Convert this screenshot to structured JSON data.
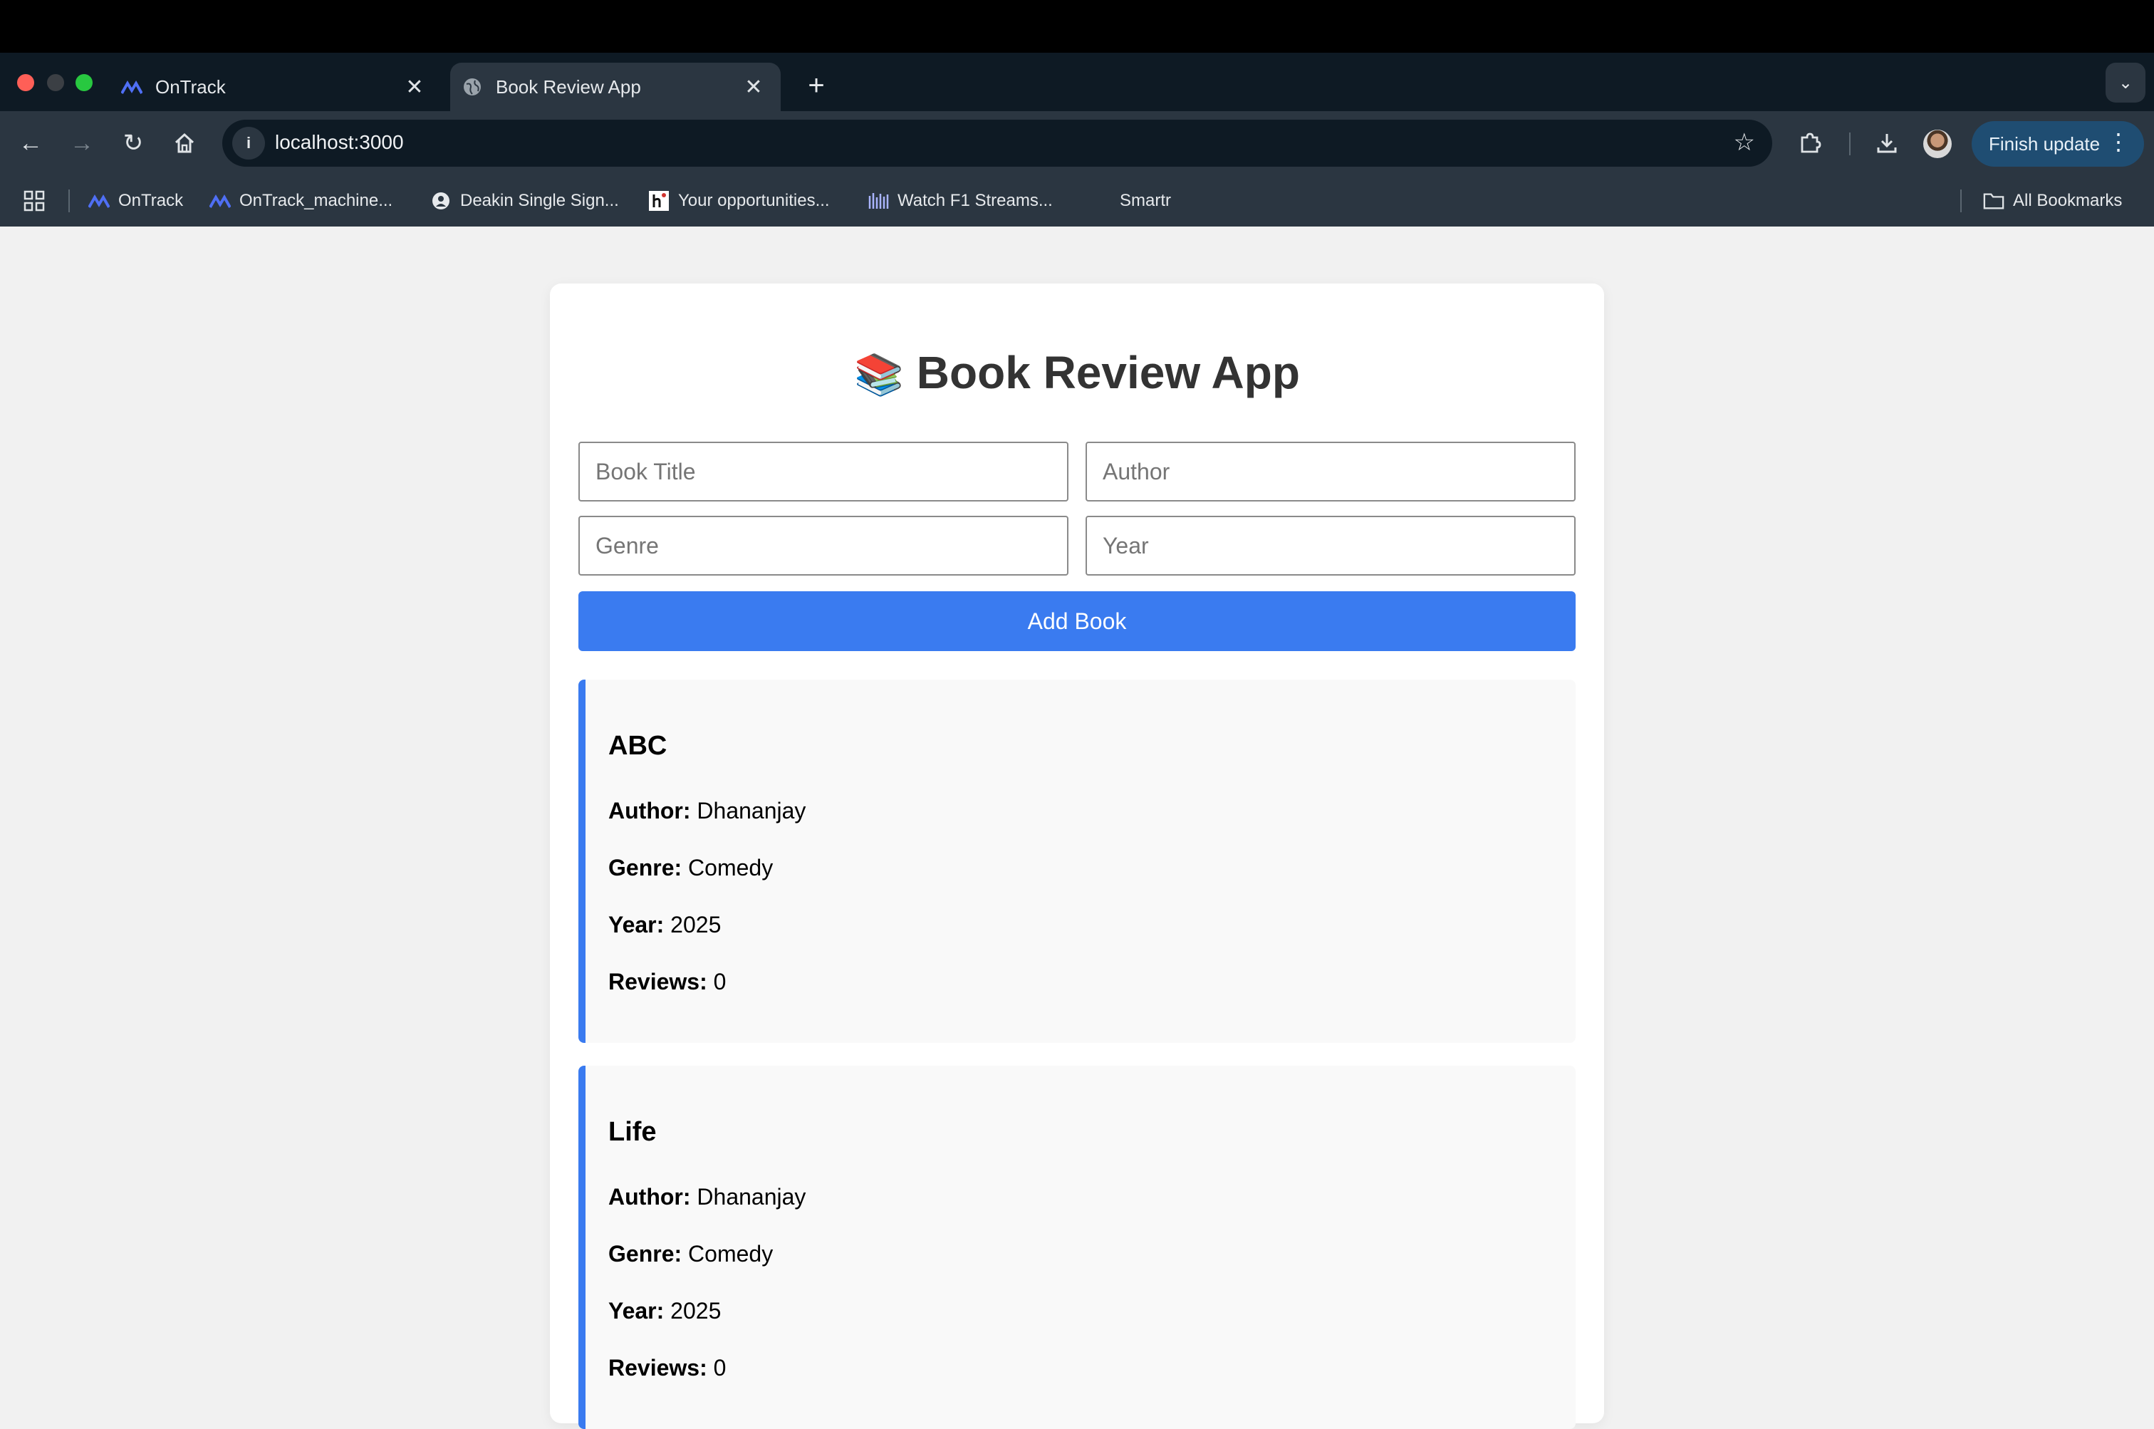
{
  "browser": {
    "tabs": [
      {
        "title": "OnTrack",
        "active": false
      },
      {
        "title": "Book Review App",
        "active": true
      }
    ],
    "url": "localhost:3000",
    "finish_update_label": "Finish update",
    "bookmarks": [
      {
        "label": "OnTrack",
        "icon": "ontrack-logo"
      },
      {
        "label": "OnTrack_machine...",
        "icon": "ontrack-logo"
      },
      {
        "label": "Deakin Single Sign...",
        "icon": "deakin-icon"
      },
      {
        "label": "Your opportunities...",
        "icon": "handshake-icon"
      },
      {
        "label": "Watch F1 Streams...",
        "icon": "f1-icon"
      },
      {
        "label": "Smartr",
        "icon": ""
      }
    ],
    "all_bookmarks_label": "All Bookmarks",
    "colors": {
      "accent": "#1f4d72",
      "tab_strip": "#0e1a24",
      "toolbar": "#2b3641"
    }
  },
  "app": {
    "emoji": "📚",
    "title": "Book Review App",
    "form": {
      "title_placeholder": "Book Title",
      "author_placeholder": "Author",
      "genre_placeholder": "Genre",
      "year_placeholder": "Year",
      "submit_label": "Add Book"
    },
    "labels": {
      "author": "Author:",
      "genre": "Genre:",
      "year": "Year:",
      "reviews": "Reviews:"
    },
    "books": [
      {
        "title": "ABC",
        "author": "Dhananjay",
        "genre": "Comedy",
        "year": "2025",
        "reviews": "0"
      },
      {
        "title": "Life",
        "author": "Dhananjay",
        "genre": "Comedy",
        "year": "2025",
        "reviews": "0"
      }
    ],
    "colors": {
      "primary": "#3a7bf0",
      "card_bg": "#f9f9f9",
      "page_bg": "#f1f1f1"
    }
  }
}
